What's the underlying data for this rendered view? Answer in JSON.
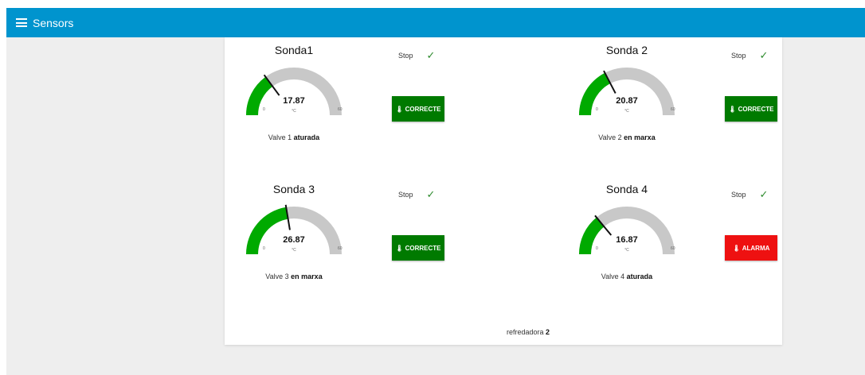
{
  "header": {
    "title": "Sensors",
    "menu_icon": "hamburger-menu-icon",
    "color": "#0094ce"
  },
  "colors": {
    "gauge_fill": "#00aa00",
    "gauge_track": "#c8c8c8",
    "ok": "#007a00",
    "alarm": "#ee1111"
  },
  "probes": [
    {
      "title": "Sonda1",
      "value": "17.87",
      "numeric_value": 17.87,
      "unit": "°C",
      "min": "0",
      "max": "60",
      "stop_label": "Stop",
      "status_label": "CORRECTE",
      "status": "ok",
      "valve_prefix": "Valve 1",
      "valve_state": "aturada"
    },
    {
      "title": "Sonda 2",
      "value": "20.87",
      "numeric_value": 20.87,
      "unit": "°C",
      "min": "0",
      "max": "60",
      "stop_label": "Stop",
      "status_label": "CORRECTE",
      "status": "ok",
      "valve_prefix": "Valve 2",
      "valve_state": "en marxa"
    },
    {
      "title": "Sonda 3",
      "value": "26.87",
      "numeric_value": 26.87,
      "unit": "°C",
      "min": "0",
      "max": "60",
      "stop_label": "Stop",
      "status_label": "CORRECTE",
      "status": "ok",
      "valve_prefix": "Valve 3",
      "valve_state": "en marxa"
    },
    {
      "title": "Sonda 4",
      "value": "16.87",
      "numeric_value": 16.87,
      "unit": "°C",
      "min": "0",
      "max": "60",
      "stop_label": "Stop",
      "status_label": "ALARMA",
      "status": "alarm",
      "valve_prefix": "Valve 4",
      "valve_state": "aturada"
    }
  ],
  "footer": {
    "prefix": "refredadora",
    "value": "2"
  }
}
